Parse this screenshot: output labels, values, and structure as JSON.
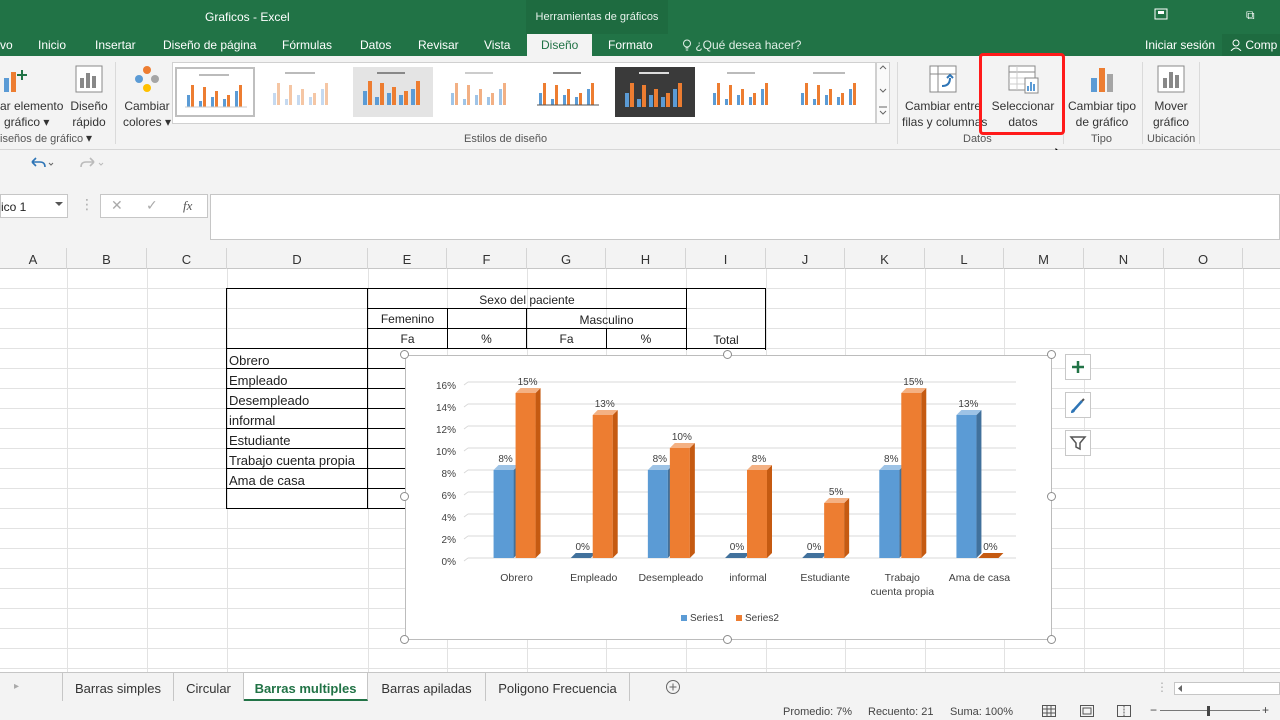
{
  "window": {
    "title": "Graficos - Excel",
    "context_tab": "Herramientas de gráficos",
    "restore_glyph": "⧉"
  },
  "tabs": {
    "items": [
      "vo",
      "Inicio",
      "Insertar",
      "Diseño de página",
      "Fórmulas",
      "Datos",
      "Revisar",
      "Vista"
    ],
    "active": "Diseño",
    "formato": "Formato",
    "tell_me": "¿Qué desea hacer?",
    "sign_in": "Iniciar sesión",
    "share": "Comp"
  },
  "ribbon": {
    "add_element": [
      "ar elemento",
      "gráfico ▾"
    ],
    "quick_layout": [
      "Diseño",
      "rápido ▾"
    ],
    "change_colors": [
      "Cambiar",
      "colores ▾"
    ],
    "group_layouts": "iseños de gráfico",
    "group_styles": "Estilos de diseño",
    "switch_row_col": [
      "Cambiar entre",
      "filas y columnas"
    ],
    "select_data": [
      "Seleccionar",
      "datos"
    ],
    "group_data": "Datos",
    "change_type": [
      "Cambiar tipo",
      "de gráfico"
    ],
    "group_type": "Tipo",
    "move_chart": [
      "Mover",
      "gráfico"
    ],
    "group_location": "Ubicación"
  },
  "formula_bar": {
    "name_box": "ico 1",
    "fx": "fx",
    "value": ""
  },
  "columns": [
    "A",
    "B",
    "C",
    "D",
    "E",
    "F",
    "G",
    "H",
    "I",
    "J",
    "K",
    "L",
    "M",
    "N",
    "O"
  ],
  "table": {
    "header_sexo": "Sexo del paciente",
    "femenino": "Femenino",
    "masculino": "Masculino",
    "fa1": "Fa",
    "pct1": "%",
    "fa2": "Fa",
    "pct2": "%",
    "total": "Total",
    "rows": [
      "Obrero",
      "Empleado",
      "Desempleado",
      "informal",
      "Estudiante",
      "Trabajo cuenta propia",
      "Ama de casa"
    ]
  },
  "colors": {
    "series1": "#5b9bd5",
    "series2": "#ed7d31",
    "excel_green": "#217346",
    "highlight": "#ff1a1a"
  },
  "chart_data": {
    "type": "bar",
    "categories": [
      "Obrero",
      "Empleado",
      "Desempleado",
      "informal",
      "Estudiante",
      "Trabajo cuenta propia",
      "Ama de casa"
    ],
    "category_lines": [
      [
        "Obrero"
      ],
      [
        "Empleado"
      ],
      [
        "Desempleado"
      ],
      [
        "informal"
      ],
      [
        "Estudiante"
      ],
      [
        "Trabajo",
        "cuenta propia"
      ],
      [
        "Ama de casa"
      ]
    ],
    "series": [
      {
        "name": "Series1",
        "values": [
          8,
          0,
          8,
          0,
          0,
          8,
          13
        ]
      },
      {
        "name": "Series2",
        "values": [
          15,
          13,
          10,
          8,
          5,
          15,
          0
        ]
      }
    ],
    "y_ticks": [
      "0%",
      "2%",
      "4%",
      "6%",
      "8%",
      "10%",
      "12%",
      "14%",
      "16%"
    ],
    "ylim": [
      0,
      16
    ],
    "grid": true,
    "legend": "bottom",
    "title": "",
    "xlabel": "",
    "ylabel": ""
  },
  "sheets": {
    "tabs": [
      "Barras simples",
      "Circular",
      "Barras multiples",
      "Barras apiladas",
      "Poligono Frecuencia"
    ],
    "active": "Barras multiples"
  },
  "status_bar": {
    "average": "Promedio: 7%",
    "count": "Recuento: 21",
    "sum": "Suma: 100%"
  }
}
